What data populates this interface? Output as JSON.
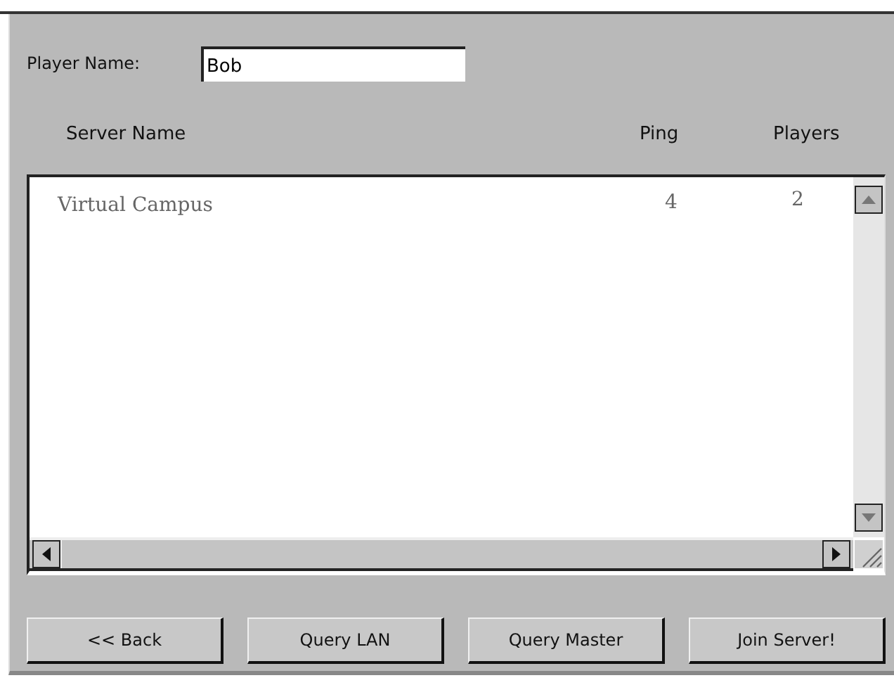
{
  "player_name": {
    "label": "Player Name:",
    "value": "Bob"
  },
  "columns": [
    "Server Name",
    "Ping",
    "Players"
  ],
  "servers": [
    {
      "name": "Virtual Campus",
      "ping": "4",
      "players": "2"
    }
  ],
  "buttons": [
    "<< Back",
    "Query LAN",
    "Query Master",
    "Join Server!"
  ]
}
